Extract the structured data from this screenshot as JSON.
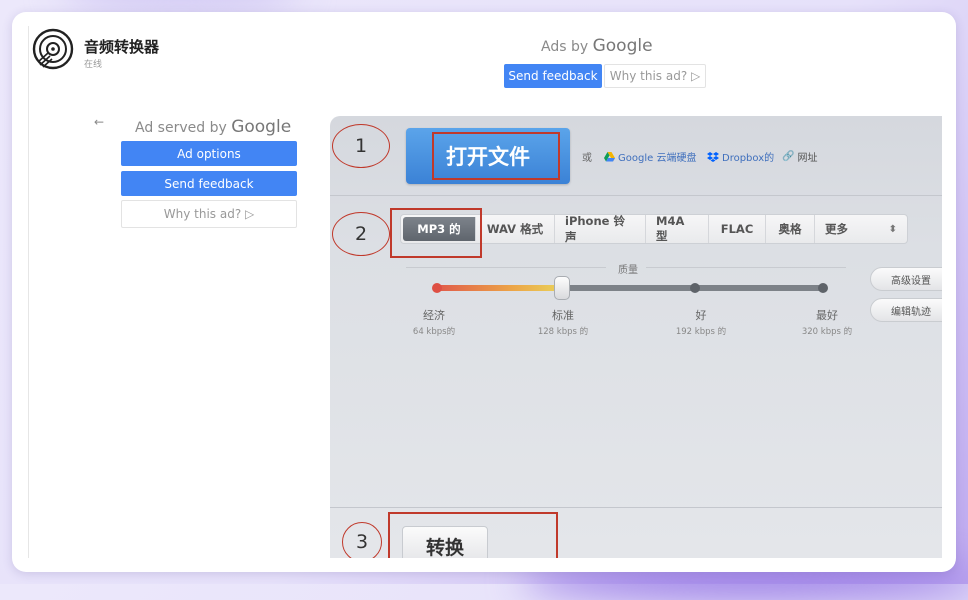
{
  "brand": {
    "title": "音频转换器",
    "subtitle": "在线"
  },
  "top_ad": {
    "ads_by": "Ads by",
    "google": "Google",
    "send_feedback": "Send feedback",
    "why": "Why this ad? ▷"
  },
  "side_ad": {
    "back": "←",
    "served_by": "Ad served by",
    "google": "Google",
    "ad_options": "Ad options",
    "send_feedback": "Send feedback",
    "why": "Why this ad? ▷"
  },
  "steps": {
    "s1": "1",
    "s2": "2",
    "s3": "3"
  },
  "open_file": "打开文件",
  "sources": {
    "or": "或",
    "gdrive": "Google 云端硬盘",
    "dropbox": "Dropbox的",
    "url": "网址"
  },
  "formats": [
    "MP3 的",
    "WAV 格式",
    "iPhone 铃声",
    "M4A 型",
    "FLAC",
    "奥格",
    "更多"
  ],
  "selected_format": "MP3 的",
  "quality": {
    "label": "质量",
    "selected_level": 1,
    "levels": [
      {
        "name": "经济",
        "rate": "64 kbps的"
      },
      {
        "name": "标准",
        "rate": "128 kbps 的"
      },
      {
        "name": "好",
        "rate": "192 kbps 的"
      },
      {
        "name": "最好",
        "rate": "320 kbps 的"
      }
    ]
  },
  "side_buttons": {
    "advanced": "高级设置",
    "edit_tracks": "编辑轨迹"
  },
  "convert": "转换",
  "colors": {
    "ad_blue": "#4285f4",
    "open_btn": "#3b82d6",
    "annotation_red": "#c0392b"
  }
}
